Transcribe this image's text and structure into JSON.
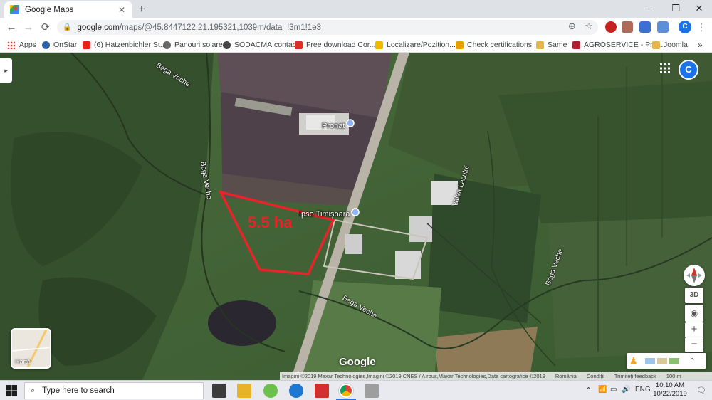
{
  "tab": {
    "title": "Google Maps",
    "close": "✕"
  },
  "newtab": "+",
  "window": {
    "minimize": "—",
    "maximize": "❐",
    "close": "✕"
  },
  "toolbar": {
    "back": "←",
    "forward": "→",
    "reload": "⟳",
    "url_host": "google.com",
    "url_rest": "/maps/@45.8447122,21.195321,1039m/data=!3m1!1e3",
    "profile_initial": "C",
    "menu": "⋮"
  },
  "bookmarks": [
    {
      "label": "Apps",
      "color": "#5f6368"
    },
    {
      "label": "OnStar",
      "color": "#2d5fa8"
    },
    {
      "label": "(6) Hatzenbichler St...",
      "color": "#e62117"
    },
    {
      "label": "Panouri solare",
      "color": "#666666"
    },
    {
      "label": "SODACMA.contact",
      "color": "#444444"
    },
    {
      "label": "Free download Cor...",
      "color": "#d93025"
    },
    {
      "label": "Localizare/Pozition...",
      "color": "#f6b700"
    },
    {
      "label": "Check certifications,...",
      "color": "#e8a000"
    },
    {
      "label": "Same",
      "color": "#e5b64b"
    },
    {
      "label": "AGROSERVICE - Pro...",
      "color": "#b01e2f"
    },
    {
      "label": "Joomla",
      "color": "#e5b64b"
    }
  ],
  "bookmarks_more": "»",
  "map": {
    "labels": {
      "bega_veche_1": "Bega Veche",
      "bega_veche_2": "Bega Veche",
      "bega_veche_3": "Bega Veche",
      "bega_veche_4": "Bega Veche",
      "valea_lacului": "Valea Lacului",
      "pronat": "Pronat",
      "ipso": "Ipso Timișoara",
      "area": "5.5 ha"
    },
    "collapse": "▸",
    "avatar_initial": "C",
    "controls": {
      "threed": "3D",
      "zoom_in": "+",
      "zoom_out": "−",
      "expand": "⌃"
    },
    "layer_label": "Hartă",
    "google": "Google",
    "attribution": {
      "imagery": "Imagini ©2019 Maxar Technologies,Imagini ©2019 CNES / Airbus,Maxar Technologies,Date cartografice ©2019",
      "country": "România",
      "terms": "Condiții",
      "feedback": "Trimiteți feedback",
      "scale": "100 m"
    },
    "accent": "#e8232a"
  },
  "taskbar": {
    "search_placeholder": "Type here to search",
    "language": "ENG",
    "time": "10:10 AM",
    "date": "10/22/2019",
    "tray_up": "⌃"
  }
}
